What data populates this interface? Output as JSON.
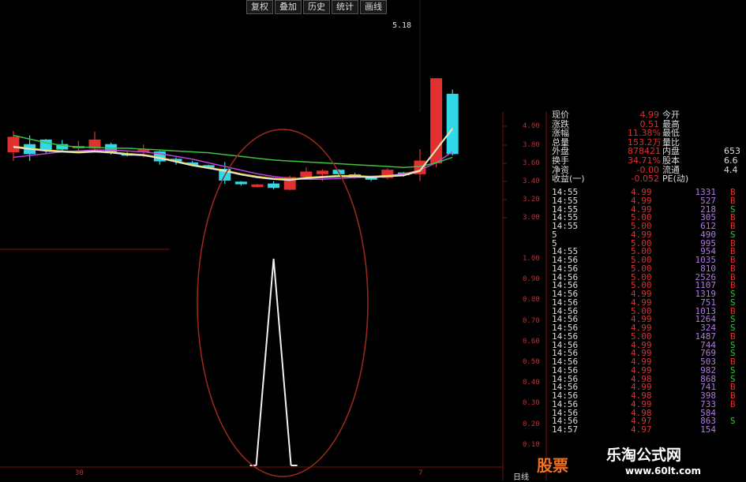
{
  "toolbar": {
    "buttons": [
      "复权",
      "叠加",
      "历史",
      "统计",
      "画线"
    ]
  },
  "price_top": "5.18",
  "main_axis": [
    "4.00",
    "3.80",
    "3.60",
    "3.40",
    "3.20",
    "3.00"
  ],
  "sub_axis": [
    "1.00",
    "0.90",
    "0.80",
    "0.70",
    "0.60",
    "0.50",
    "0.40",
    "0.30",
    "0.20",
    "0.10"
  ],
  "x_labels": {
    "left": "30",
    "right": "7",
    "corner": "日线"
  },
  "quote": [
    {
      "k1": "现价",
      "v1": "4.99",
      "k2": "今开",
      "v2": ""
    },
    {
      "k1": "涨跌",
      "v1": "0.51",
      "k2": "最高",
      "v2": ""
    },
    {
      "k1": "涨幅",
      "v1": "11.38%",
      "k2": "最低",
      "v2": ""
    },
    {
      "k1": "总量",
      "v1": "153.2万",
      "k2": "量比",
      "v2": ""
    },
    {
      "k1": "外盘",
      "v1": "878421",
      "k2": "内盘",
      "v2": "653"
    },
    {
      "k1": "换手",
      "v1": "34.71%",
      "k2": "股本",
      "v2": "6.6"
    },
    {
      "k1": "净资",
      "v1": "-0.00",
      "k2": "流通",
      "v2": "4.4"
    },
    {
      "k1": "收益(一)",
      "v1": "-0.052",
      "k2": "PE(动)",
      "v2": ""
    }
  ],
  "ticks": [
    {
      "t": "14:55",
      "p": "4.99",
      "v": "1331",
      "s": "B"
    },
    {
      "t": "14:55",
      "p": "4.99",
      "v": "527",
      "s": "B"
    },
    {
      "t": "14:55",
      "p": "4.99",
      "v": "218",
      "s": "S"
    },
    {
      "t": "14:55",
      "p": "5.00",
      "v": "305",
      "s": "B"
    },
    {
      "t": "14:55",
      "p": "5.00",
      "v": "612",
      "s": "B"
    },
    {
      "t": "5",
      "p": "4.99",
      "v": "490",
      "s": "S"
    },
    {
      "t": "5",
      "p": "5.00",
      "v": "995",
      "s": "B"
    },
    {
      "t": "14:55",
      "p": "5.00",
      "v": "954",
      "s": "B"
    },
    {
      "t": "14:56",
      "p": "5.00",
      "v": "1035",
      "s": "B"
    },
    {
      "t": "14:56",
      "p": "5.00",
      "v": "810",
      "s": "B"
    },
    {
      "t": "14:56",
      "p": "5.00",
      "v": "2526",
      "s": "B"
    },
    {
      "t": "14:56",
      "p": "5.00",
      "v": "1107",
      "s": "B"
    },
    {
      "t": "14:56",
      "p": "4.99",
      "v": "1319",
      "s": "S"
    },
    {
      "t": "14:56",
      "p": "4.99",
      "v": "751",
      "s": "S"
    },
    {
      "t": "14:56",
      "p": "5.00",
      "v": "1013",
      "s": "B"
    },
    {
      "t": "14:56",
      "p": "4.99",
      "v": "1264",
      "s": "S"
    },
    {
      "t": "14:56",
      "p": "4.99",
      "v": "324",
      "s": "S"
    },
    {
      "t": "14:56",
      "p": "5.00",
      "v": "1487",
      "s": "B"
    },
    {
      "t": "14:56",
      "p": "4.99",
      "v": "744",
      "s": "S"
    },
    {
      "t": "14:56",
      "p": "4.99",
      "v": "769",
      "s": "S"
    },
    {
      "t": "14:56",
      "p": "4.99",
      "v": "503",
      "s": "B"
    },
    {
      "t": "14:56",
      "p": "4.99",
      "v": "982",
      "s": "S"
    },
    {
      "t": "14:56",
      "p": "4.98",
      "v": "868",
      "s": "S"
    },
    {
      "t": "14:56",
      "p": "4.99",
      "v": "741",
      "s": "B"
    },
    {
      "t": "14:56",
      "p": "4.98",
      "v": "398",
      "s": "B"
    },
    {
      "t": "14:56",
      "p": "4.99",
      "v": "733",
      "s": "B"
    },
    {
      "t": "14:56",
      "p": "4.98",
      "v": "584",
      "s": ""
    },
    {
      "t": "14:56",
      "p": "4.97",
      "v": "863",
      "s": "S"
    },
    {
      "t": "14:57",
      "p": "4.97",
      "v": "154",
      "s": ""
    }
  ],
  "colors": {
    "up": "#e03030",
    "down": "#30d8e8",
    "ma_white": "#e8e8e8",
    "ma_yellow": "#e8d040",
    "ma_green": "#40c040",
    "ma_purple": "#c040e0",
    "axis": "#7a1010",
    "ellipse": "#a02a1a",
    "buy": "#e03030",
    "sell": "#40c040"
  },
  "candles": [
    {
      "o": 3.72,
      "h": 3.95,
      "l": 3.62,
      "c": 3.88
    },
    {
      "o": 3.8,
      "h": 3.9,
      "l": 3.62,
      "c": 3.7
    },
    {
      "o": 3.85,
      "h": 3.86,
      "l": 3.7,
      "c": 3.74
    },
    {
      "o": 3.8,
      "h": 3.85,
      "l": 3.73,
      "c": 3.75
    },
    {
      "o": 3.77,
      "h": 3.84,
      "l": 3.73,
      "c": 3.78
    },
    {
      "o": 3.76,
      "h": 3.94,
      "l": 3.72,
      "c": 3.85
    },
    {
      "o": 3.8,
      "h": 3.82,
      "l": 3.69,
      "c": 3.71
    },
    {
      "o": 3.7,
      "h": 3.72,
      "l": 3.67,
      "c": 3.69
    },
    {
      "o": 3.72,
      "h": 3.8,
      "l": 3.66,
      "c": 3.74
    },
    {
      "o": 3.72,
      "h": 3.73,
      "l": 3.58,
      "c": 3.62
    },
    {
      "o": 3.64,
      "h": 3.66,
      "l": 3.58,
      "c": 3.62
    },
    {
      "o": 3.6,
      "h": 3.62,
      "l": 3.57,
      "c": 3.59
    },
    {
      "o": 3.57,
      "h": 3.58,
      "l": 3.54,
      "c": 3.56
    },
    {
      "o": 3.53,
      "h": 3.61,
      "l": 3.37,
      "c": 3.41
    },
    {
      "o": 3.39,
      "h": 3.4,
      "l": 3.35,
      "c": 3.37
    },
    {
      "o": 3.34,
      "h": 3.37,
      "l": 3.33,
      "c": 3.36
    },
    {
      "o": 3.37,
      "h": 3.4,
      "l": 3.31,
      "c": 3.33
    },
    {
      "o": 3.31,
      "h": 3.46,
      "l": 3.3,
      "c": 3.44
    },
    {
      "o": 3.45,
      "h": 3.55,
      "l": 3.42,
      "c": 3.5
    },
    {
      "o": 3.48,
      "h": 3.53,
      "l": 3.4,
      "c": 3.51
    },
    {
      "o": 3.52,
      "h": 3.53,
      "l": 3.46,
      "c": 3.48
    },
    {
      "o": 3.47,
      "h": 3.49,
      "l": 3.43,
      "c": 3.44
    },
    {
      "o": 3.44,
      "h": 3.46,
      "l": 3.4,
      "c": 3.42
    },
    {
      "o": 3.44,
      "h": 3.54,
      "l": 3.42,
      "c": 3.52
    },
    {
      "o": 3.49,
      "h": 3.5,
      "l": 3.45,
      "c": 3.47
    },
    {
      "o": 3.48,
      "h": 3.75,
      "l": 3.4,
      "c": 3.62
    },
    {
      "o": 3.6,
      "h": 4.52,
      "l": 3.55,
      "c": 4.52
    },
    {
      "o": 4.35,
      "h": 4.4,
      "l": 3.68,
      "c": 3.7
    }
  ],
  "ma_white": [
    3.78,
    3.76,
    3.74,
    3.73,
    3.72,
    3.73,
    3.72,
    3.7,
    3.69,
    3.66,
    3.62,
    3.58,
    3.55,
    3.52,
    3.48,
    3.45,
    3.43,
    3.42,
    3.44,
    3.45,
    3.46,
    3.46,
    3.45,
    3.46,
    3.47,
    3.52,
    3.75,
    3.98
  ],
  "ma_green": [
    3.9,
    3.86,
    3.82,
    3.79,
    3.77,
    3.77,
    3.76,
    3.76,
    3.75,
    3.74,
    3.73,
    3.72,
    3.71,
    3.69,
    3.67,
    3.65,
    3.63,
    3.62,
    3.61,
    3.6,
    3.59,
    3.58,
    3.57,
    3.56,
    3.55,
    3.56,
    3.6,
    3.66
  ],
  "ma_purple": [
    3.66,
    3.68,
    3.7,
    3.72,
    3.73,
    3.74,
    3.74,
    3.73,
    3.72,
    3.7,
    3.67,
    3.64,
    3.6,
    3.56,
    3.52,
    3.48,
    3.45,
    3.43,
    3.42,
    3.42,
    3.43,
    3.44,
    3.45,
    3.46,
    3.48,
    3.52,
    3.6,
    3.72
  ],
  "signal": [
    0,
    0,
    0,
    0,
    0,
    0,
    0,
    0,
    0,
    0,
    0,
    0,
    0,
    0,
    0,
    0,
    1,
    0,
    0,
    0,
    0,
    0,
    0,
    0,
    0,
    0,
    0,
    0
  ],
  "watermark": {
    "text": "乐淘公式网",
    "url": "www.60lt.com",
    "logo": "股票"
  }
}
